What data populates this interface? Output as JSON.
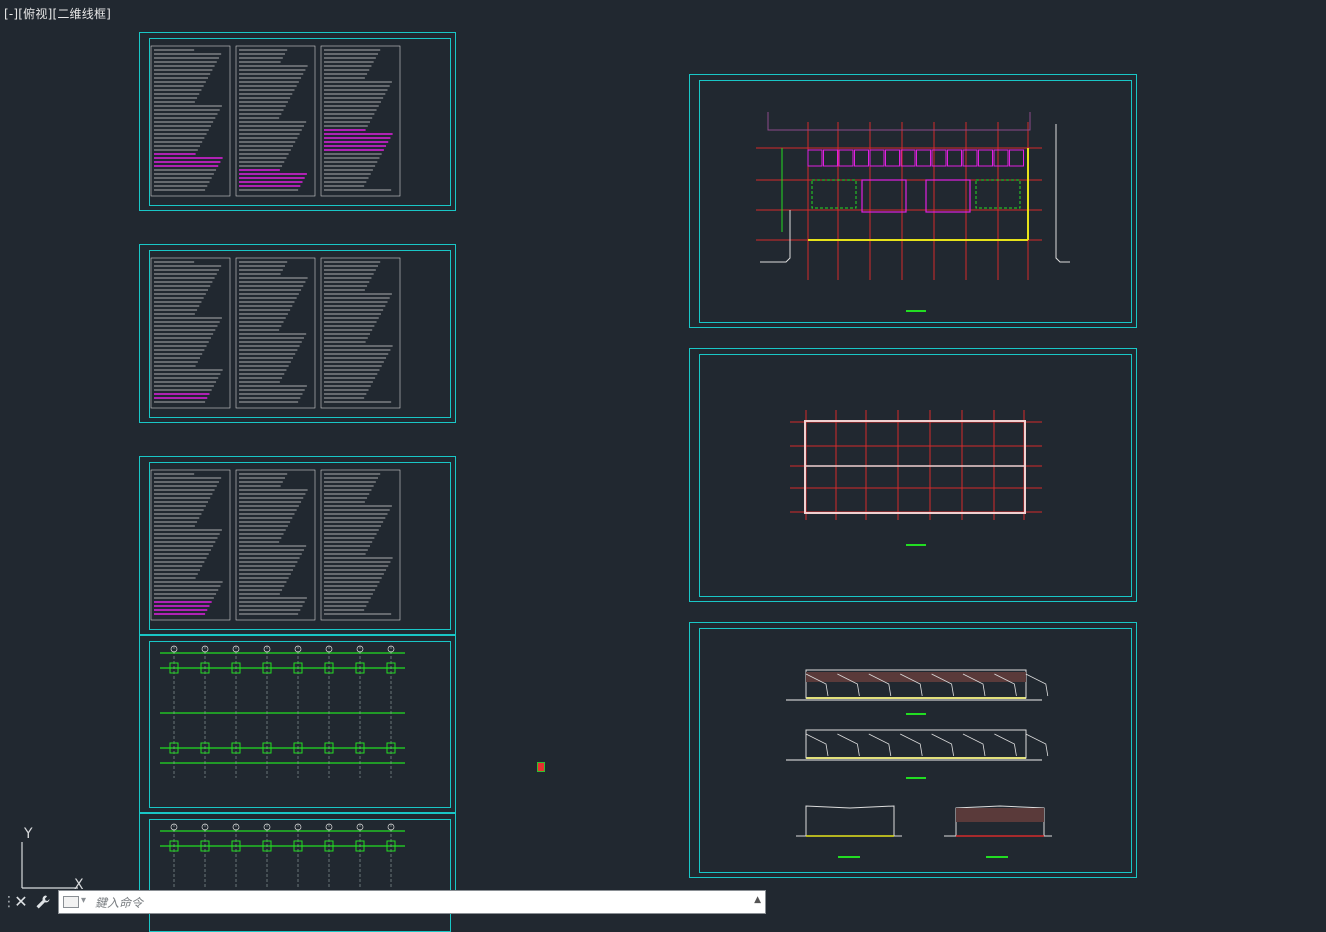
{
  "viewport": {
    "label_prefix": "[-]",
    "view_name": "[俯视]",
    "visual_style": "[二维线框]"
  },
  "colors": {
    "background": "#212830",
    "frame": "#19c6c6",
    "grid_red": "#d42a2a",
    "magenta": "#e020e0",
    "green": "#22dd22",
    "yellow": "#e6e21a",
    "white": "#e8e8e8"
  },
  "command_line": {
    "placeholder": "鍵入命令",
    "close_icon": "close-icon",
    "customize_icon": "wrench-icon"
  },
  "ucs": {
    "y_label": "Y",
    "x_label": "X"
  },
  "sheets": [
    {
      "id": "notes-1",
      "kind": "text-notes"
    },
    {
      "id": "notes-2",
      "kind": "text-notes"
    },
    {
      "id": "notes-3",
      "kind": "text-notes-with-table"
    },
    {
      "id": "foundation-plan",
      "kind": "column-grid-plan"
    },
    {
      "id": "foundation-plan-2",
      "kind": "column-grid-plan"
    },
    {
      "id": "roof-plan",
      "kind": "steel-roof-plan"
    },
    {
      "id": "frame-plan",
      "kind": "grid-plan"
    },
    {
      "id": "elevations",
      "kind": "elevations-and-sections"
    }
  ]
}
